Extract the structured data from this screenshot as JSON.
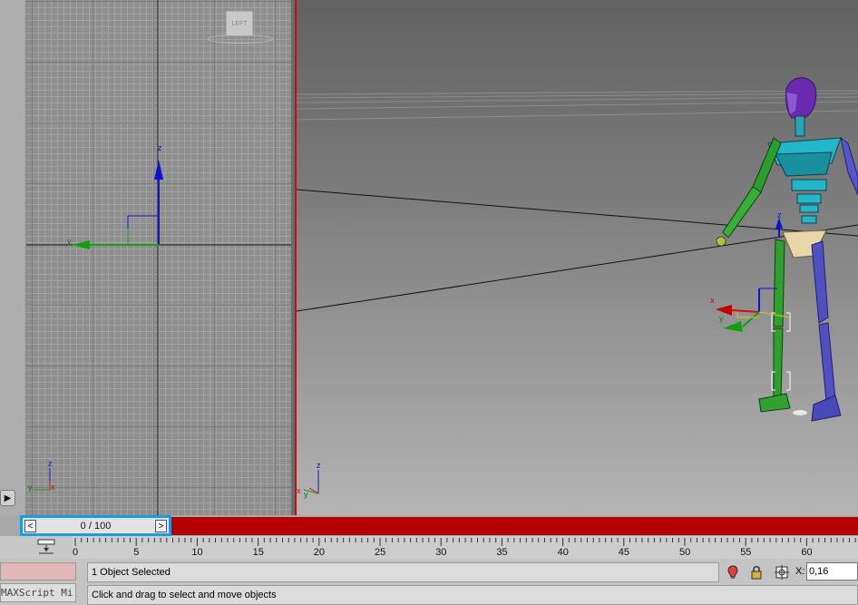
{
  "viewports": {
    "left": {
      "viewcube_label": "LEFT",
      "axes": {
        "z": "z",
        "y": "y",
        "x": "x"
      }
    },
    "perspective": {
      "axes": {
        "z": "z",
        "x": "x",
        "y": "y"
      },
      "gizmo": {
        "x": "x",
        "y": "y",
        "z": "z"
      }
    }
  },
  "time_slider": {
    "prev_label": "<",
    "next_label": ">",
    "frame_text": "0 / 100"
  },
  "track_bar": {
    "ticks": [
      "0",
      "5",
      "10",
      "15",
      "20",
      "25",
      "30",
      "35",
      "40",
      "45",
      "50",
      "55",
      "60"
    ]
  },
  "status": {
    "selection_text": "1 Object Selected",
    "prompt_text": "Click and drag to select and move objects",
    "maxscript_label": "MAXScript Mi",
    "x_label": "X:",
    "x_value": "0,16"
  },
  "colors": {
    "active_border": "#c41010",
    "time_bar": "#b50000",
    "highlight": "#1d9be0"
  }
}
